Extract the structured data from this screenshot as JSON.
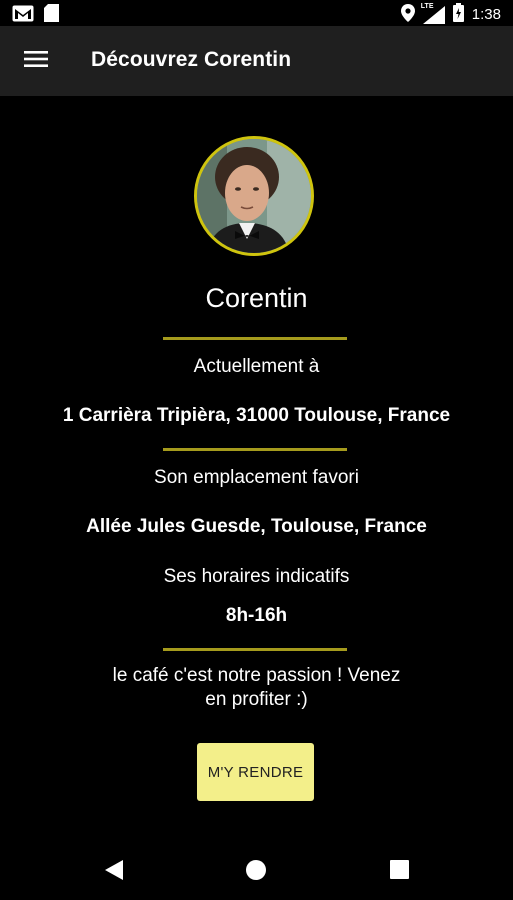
{
  "status_bar": {
    "time": "1:38",
    "network_label": "LTE",
    "icons": [
      "gmail-icon",
      "sd-card-icon",
      "location-icon",
      "signal-icon",
      "battery-icon"
    ]
  },
  "app_bar": {
    "title": "Découvrez Corentin",
    "menu_icon": "hamburger-menu-icon"
  },
  "profile": {
    "name": "Corentin",
    "current_location_label": "Actuellement à",
    "current_location": "1 Carrièra Tripièra, 31000 Toulouse, France",
    "favorite_location_label": "Son emplacement favori",
    "favorite_location": "Allée Jules Guesde, Toulouse, France",
    "hours_label": "Ses horaires indicatifs",
    "hours": "8h-16h",
    "passion_line1": "le café c'est notre passion ! Venez",
    "passion_line2": "en profiter :)",
    "action_label": "M'Y RENDRE"
  },
  "colors": {
    "accent": "#cfc40e",
    "divider": "#a59b1d",
    "button": "#f3ef8a",
    "app_bar": "#1f1f1f",
    "background": "#000000"
  },
  "nav_bar": {
    "icons": [
      "back-icon",
      "home-icon",
      "recents-icon"
    ]
  }
}
